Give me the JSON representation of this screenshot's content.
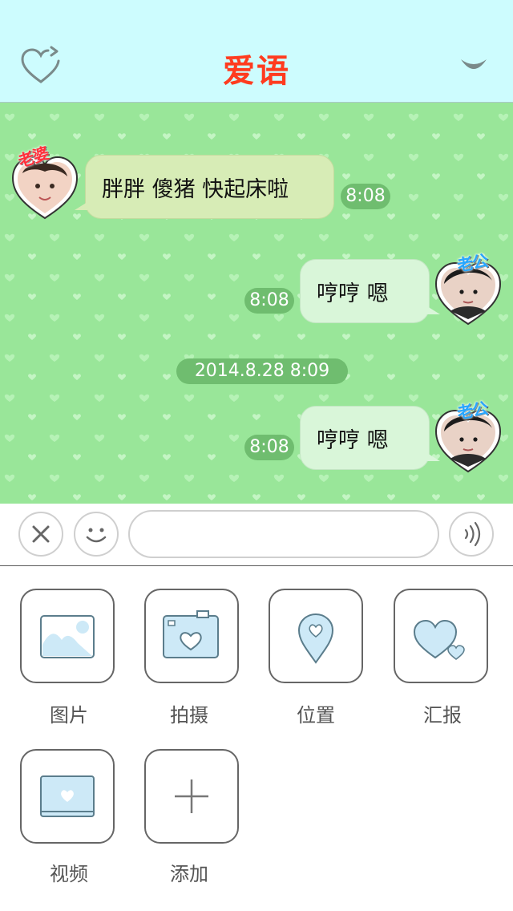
{
  "header": {
    "title": "爱语",
    "left_icon": "heart-refresh-icon",
    "right_icon": "chevron-down-icon",
    "title_color": "#ff3b1f",
    "background": "#cdfcfe"
  },
  "chat": {
    "background": "#99e699",
    "messages": [
      {
        "sender_label": "老婆",
        "text": "胖胖 傻猪 快起床啦",
        "time": "8:08"
      },
      {
        "sender_label": "老公",
        "text": "哼哼 嗯",
        "time": "8:08"
      },
      {
        "sender_label": "老公",
        "text": "哼哼 嗯",
        "time": "8:08"
      }
    ],
    "date_separator": "2014.8.28 8:09"
  },
  "input_bar": {
    "close_icon": "close-icon",
    "emoji_icon": "smiley-icon",
    "voice_icon": "voice-wave-icon",
    "text_value": ""
  },
  "panel": {
    "items": [
      {
        "label": "图片",
        "icon": "image-icon"
      },
      {
        "label": "拍摄",
        "icon": "camera-icon"
      },
      {
        "label": "位置",
        "icon": "location-pin-icon"
      },
      {
        "label": "汇报",
        "icon": "hearts-icon"
      },
      {
        "label": "视频",
        "icon": "video-icon"
      },
      {
        "label": "添加",
        "icon": "plus-icon"
      }
    ]
  }
}
